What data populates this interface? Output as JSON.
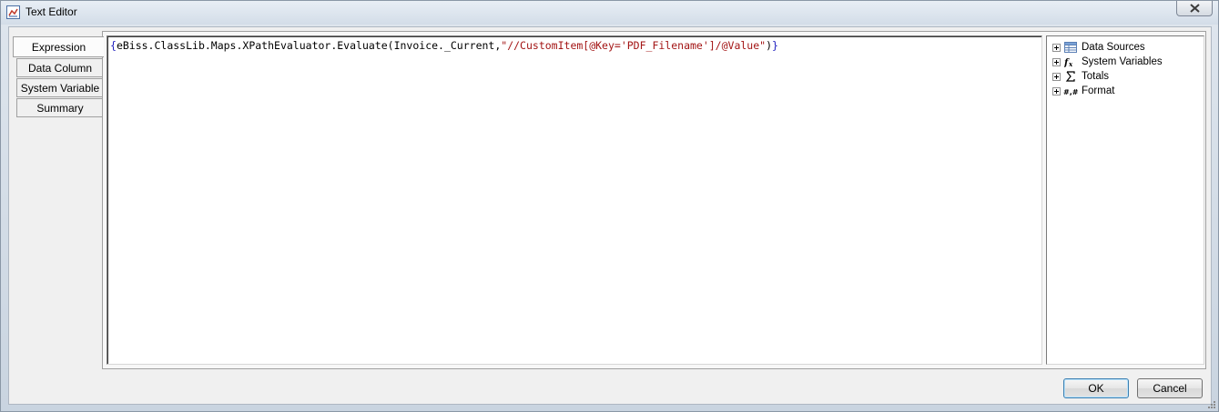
{
  "window": {
    "title": "Text Editor",
    "close_icon": "close-icon"
  },
  "tabs": [
    {
      "label": "Expression",
      "active": true
    },
    {
      "label": "Data Column",
      "active": false
    },
    {
      "label": "System Variable",
      "active": false
    },
    {
      "label": "Summary",
      "active": false
    }
  ],
  "editor": {
    "tokens": {
      "open_brace": "{",
      "ident": "eBiss.ClassLib.Maps.XPathEvaluator.Evaluate(Invoice._Current,",
      "string": "\"//CustomItem[@Key='PDF_Filename']/@Value\"",
      "close_paren": ")",
      "close_brace": "}"
    }
  },
  "tree": {
    "items": [
      {
        "label": "Data Sources",
        "icon": "table-icon"
      },
      {
        "label": "System Variables",
        "icon": "function-icon"
      },
      {
        "label": "Totals",
        "icon": "sigma-icon"
      },
      {
        "label": "Format",
        "icon": "format-icon"
      }
    ]
  },
  "buttons": {
    "ok": "OK",
    "cancel": "Cancel"
  }
}
